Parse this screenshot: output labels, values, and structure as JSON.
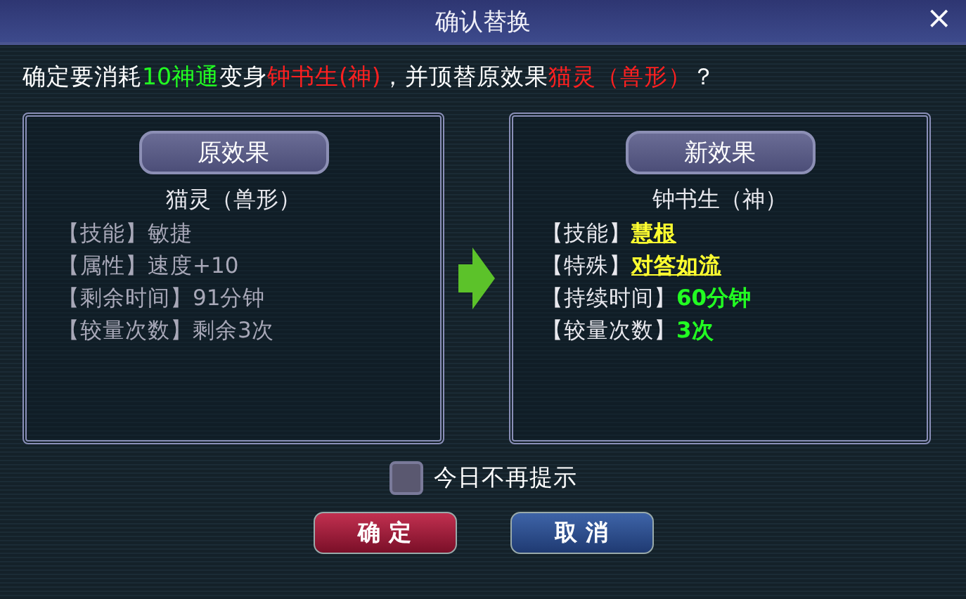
{
  "window": {
    "title": "确认替换",
    "close": "×"
  },
  "message": [
    {
      "text": "确定要消耗",
      "kind": "plain"
    },
    {
      "text": "10神通",
      "kind": "cost"
    },
    {
      "text": "变身",
      "kind": "plain"
    },
    {
      "text": "钟书生(神)",
      "kind": "target"
    },
    {
      "text": "，并顶替原效果",
      "kind": "plain"
    },
    {
      "text": "猫灵（兽形）",
      "kind": "target"
    },
    {
      "text": "？",
      "kind": "plain"
    }
  ],
  "panels": [
    {
      "heading": "原效果",
      "name": "猫灵（兽形）",
      "rows": [
        {
          "label": "【技能】",
          "value": "敏捷",
          "kind": "old"
        },
        {
          "label": "【属性】",
          "value": "速度+10",
          "kind": "old"
        },
        {
          "label": "【剩余时间】",
          "value": "91分钟",
          "kind": "old"
        },
        {
          "label": "【较量次数】",
          "value": "剩余3次",
          "kind": "old"
        }
      ]
    },
    {
      "heading": "新效果",
      "name": "钟书生（神）",
      "rows": [
        {
          "label": "【技能】",
          "value": "慧根",
          "kind": "link"
        },
        {
          "label": "【特殊】",
          "value": "对答如流",
          "kind": "link"
        },
        {
          "label": "【持续时间】",
          "value": "60分钟",
          "kind": "good"
        },
        {
          "label": "【较量次数】",
          "value": "3次",
          "kind": "good"
        }
      ]
    }
  ],
  "dont_remind": {
    "label": "今日不再提示",
    "checked": false
  },
  "buttons": [
    {
      "label": "确 定",
      "kind": "confirm"
    },
    {
      "label": "取 消",
      "kind": "cancel"
    }
  ]
}
